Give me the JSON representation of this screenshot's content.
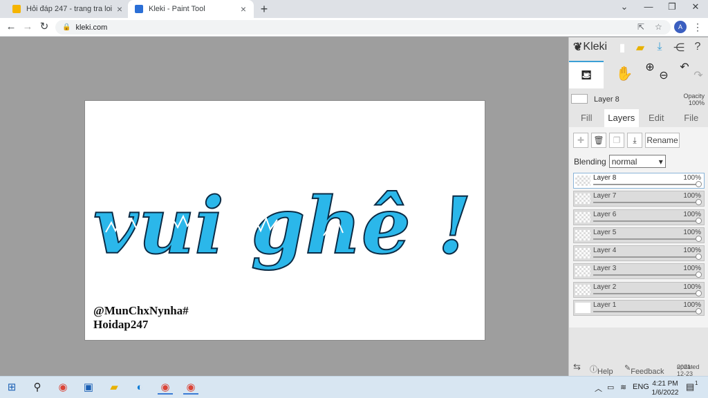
{
  "browser": {
    "tabs": [
      {
        "title": "Hỏi đáp 247 - trang tra loi",
        "favicon_color": "#f5b400"
      },
      {
        "title": "Kleki - Paint Tool",
        "favicon_color": "#2b6fd6"
      }
    ],
    "new_tab": "+",
    "url": "kleki.com",
    "profile_initial": "A",
    "window": {
      "minimize": "—",
      "maximize": "❐",
      "close": "✕",
      "dropdown": "⌄"
    }
  },
  "canvas": {
    "artwork_text": "vui ghê !",
    "artwork_color": "#2bb7ea",
    "credit_line1": "@MunChxNynha#",
    "credit_line2": "Hoidap247"
  },
  "panel": {
    "brand": "Kleki",
    "current_layer": {
      "name": "Layer 8",
      "opacity_label": "Opacity",
      "opacity_value": "100%"
    },
    "tabs": [
      "Fill",
      "Layers",
      "Edit",
      "File"
    ],
    "active_tab": "Layers",
    "rename_label": "Rename",
    "blending_label": "Blending",
    "blending_value": "normal",
    "layers": [
      {
        "name": "Layer 8",
        "opacity": "100%",
        "active": true
      },
      {
        "name": "Layer 7",
        "opacity": "100%",
        "active": false
      },
      {
        "name": "Layer 6",
        "opacity": "100%",
        "active": false
      },
      {
        "name": "Layer 5",
        "opacity": "100%",
        "active": false
      },
      {
        "name": "Layer 4",
        "opacity": "100%",
        "active": false
      },
      {
        "name": "Layer 3",
        "opacity": "100%",
        "active": false
      },
      {
        "name": "Layer 2",
        "opacity": "100%",
        "active": false
      },
      {
        "name": "Layer 1",
        "opacity": "100%",
        "active": false
      }
    ],
    "footer": {
      "help": "Help",
      "feedback": "Feedback",
      "updated_label": "updated",
      "updated_date": "2021-12-23"
    },
    "accent_color": "#3a9fd6"
  },
  "taskbar": {
    "language": "ENG",
    "time": "4:21 PM",
    "date": "1/6/2022",
    "notification_count": "1"
  }
}
